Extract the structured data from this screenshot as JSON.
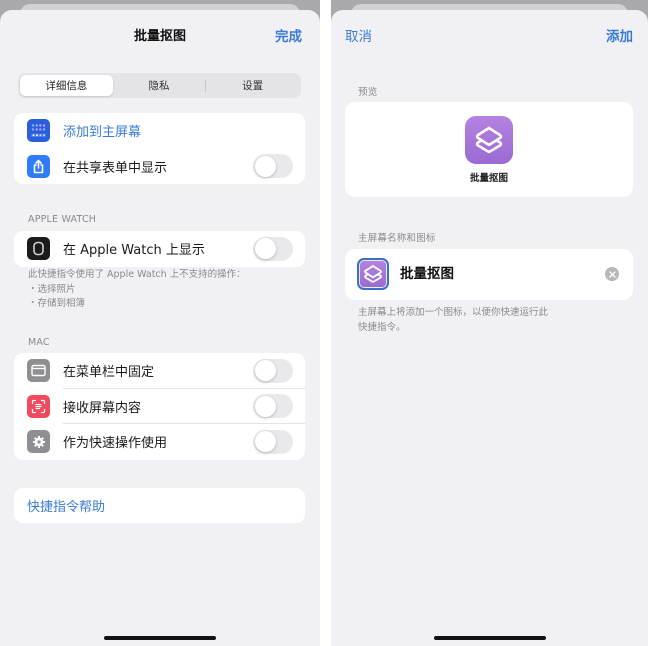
{
  "left_panel": {
    "title": "批量抠图",
    "done_label": "完成",
    "tabs": [
      {
        "label": "详细信息",
        "active": true
      },
      {
        "label": "隐私",
        "active": false
      },
      {
        "label": "设置",
        "active": false
      }
    ],
    "group1": [
      {
        "label": "添加到主屏幕",
        "icon": "home-screen-grid-icon",
        "icon_color": "#2b5fd9",
        "is_link": true
      },
      {
        "label": "在共享表单中显示",
        "icon": "share-icon",
        "icon_color": "#2f7cf6",
        "toggle": false
      }
    ],
    "apple_watch": {
      "header": "APPLE WATCH",
      "row": {
        "label": "在 Apple Watch 上显示",
        "icon": "apple-watch-icon",
        "icon_color": "#1c1c1e",
        "toggle": false
      },
      "footnote_lines": [
        "此快捷指令使用了 Apple Watch 上不支持的操作：",
        "・选择照片",
        "・存储到相簿"
      ]
    },
    "mac": {
      "header": "MAC",
      "rows": [
        {
          "label": "在菜单栏中固定",
          "icon": "menu-bar-icon",
          "icon_color": "#8e8e93",
          "toggle": false
        },
        {
          "label": "接收屏幕内容",
          "icon": "screen-capture-icon",
          "icon_color": "#ef4a5e",
          "toggle": false
        },
        {
          "label": "作为快速操作使用",
          "icon": "gear-icon",
          "icon_color": "#8e8e93",
          "toggle": false
        }
      ]
    },
    "help_link": "快捷指令帮助"
  },
  "right_panel": {
    "cancel_label": "取消",
    "add_label": "添加",
    "preview_header": "预览",
    "preview_app_name": "批量抠图",
    "name_icon_header": "主屏幕名称和图标",
    "name_value": "批量抠图",
    "footnote_lines": [
      "主屏幕上将添加一个图标，以便你快速运行此",
      "快捷指令。"
    ],
    "icon_color": "#a674db"
  }
}
